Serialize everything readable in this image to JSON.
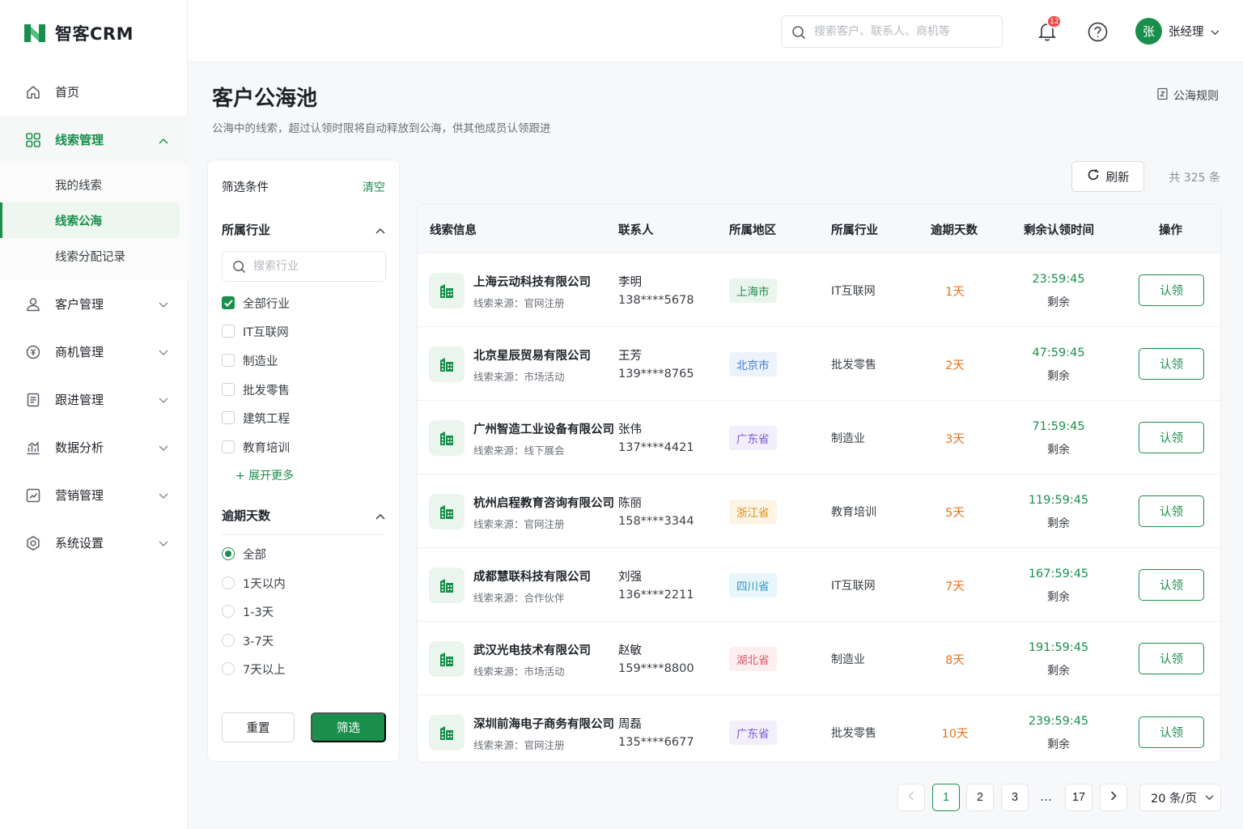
{
  "app": {
    "name": "智客CRM",
    "brand_color": "#1a8f4c"
  },
  "sidebar": {
    "items": [
      {
        "label": "首页",
        "icon": "home-icon"
      },
      {
        "label": "线索管理",
        "icon": "grid-icon",
        "expanded": true,
        "children": [
          {
            "label": "我的线索"
          },
          {
            "label": "线索公海",
            "active": true
          },
          {
            "label": "线索分配记录"
          }
        ]
      },
      {
        "label": "客户管理",
        "icon": "user-icon"
      },
      {
        "label": "商机管理",
        "icon": "coin-icon"
      },
      {
        "label": "跟进管理",
        "icon": "document-icon"
      },
      {
        "label": "数据分析",
        "icon": "chart-icon"
      },
      {
        "label": "营销管理",
        "icon": "marketing-icon"
      },
      {
        "label": "系统设置",
        "icon": "gear-icon"
      }
    ]
  },
  "header": {
    "search_placeholder": "搜索客户、联系人、商机等",
    "notification_count": "12",
    "user": {
      "avatar_text": "张",
      "name": "张经理"
    }
  },
  "page": {
    "title": "客户公海池",
    "description": "公海中的线索，超过认领时限将自动释放到公海，供其他成员认领跟进",
    "rules_link": "公海规则"
  },
  "filter": {
    "title": "筛选条件",
    "clear": "清空",
    "industry_section": "所属行业",
    "industry_search_placeholder": "搜索行业",
    "industry_options": [
      {
        "label": "全部行业",
        "checked": true
      },
      {
        "label": "IT互联网",
        "checked": false
      },
      {
        "label": "制造业",
        "checked": false
      },
      {
        "label": "批发零售",
        "checked": false
      },
      {
        "label": "建筑工程",
        "checked": false
      },
      {
        "label": "教育培训",
        "checked": false
      }
    ],
    "expand_more": "+ 展开更多",
    "overdue_section": "逾期天数",
    "overdue_options": [
      {
        "label": "全部",
        "selected": true
      },
      {
        "label": "1天以内",
        "selected": false
      },
      {
        "label": "1-3天",
        "selected": false
      },
      {
        "label": "3-7天",
        "selected": false
      },
      {
        "label": "7天以上",
        "selected": false
      }
    ],
    "reset_label": "重置",
    "submit_label": "筛选"
  },
  "toolbar": {
    "refresh_label": "刷新",
    "total_text": "共 325 条"
  },
  "table": {
    "columns": [
      "线索信息",
      "联系人",
      "所属地区",
      "所属行业",
      "逾期天数",
      "剩余认领时间",
      "操作"
    ],
    "rows": [
      {
        "company": "上海云动科技有限公司",
        "source": "线索来源：官网注册",
        "contact": "李明",
        "phone": "138****5678",
        "region": "上海市",
        "region_color": "#1a8f4c",
        "region_bg": "#eaf5ee",
        "industry": "IT互联网",
        "overdue": "1天",
        "remaining": "23:59:45",
        "remaining_label": "剩余",
        "action": "认领"
      },
      {
        "company": "北京星辰贸易有限公司",
        "source": "线索来源：市场活动",
        "contact": "王芳",
        "phone": "139****8765",
        "region": "北京市",
        "region_color": "#3b7bd8",
        "region_bg": "#ecf3fd",
        "industry": "批发零售",
        "overdue": "2天",
        "remaining": "47:59:45",
        "remaining_label": "剩余",
        "action": "认领"
      },
      {
        "company": "广州智造工业设备有限公司",
        "source": "线索来源：线下展会",
        "contact": "张伟",
        "phone": "137****4421",
        "region": "广东省",
        "region_color": "#7a5bd1",
        "region_bg": "#f2eefc",
        "industry": "制造业",
        "overdue": "3天",
        "remaining": "71:59:45",
        "remaining_label": "剩余",
        "action": "认领"
      },
      {
        "company": "杭州启程教育咨询有限公司",
        "source": "线索来源：官网注册",
        "contact": "陈丽",
        "phone": "158****3344",
        "region": "浙江省",
        "region_color": "#d6901c",
        "region_bg": "#fdf4e4",
        "industry": "教育培训",
        "overdue": "5天",
        "remaining": "119:59:45",
        "remaining_label": "剩余",
        "action": "认领"
      },
      {
        "company": "成都慧联科技有限公司",
        "source": "线索来源：合作伙伴",
        "contact": "刘强",
        "phone": "136****2211",
        "region": "四川省",
        "region_color": "#2f97c9",
        "region_bg": "#e8f5fb",
        "industry": "IT互联网",
        "overdue": "7天",
        "remaining": "167:59:45",
        "remaining_label": "剩余",
        "action": "认领"
      },
      {
        "company": "武汉光电技术有限公司",
        "source": "线索来源：市场活动",
        "contact": "赵敏",
        "phone": "159****8800",
        "region": "湖北省",
        "region_color": "#e0566a",
        "region_bg": "#fdeef0",
        "industry": "制造业",
        "overdue": "8天",
        "remaining": "191:59:45",
        "remaining_label": "剩余",
        "action": "认领"
      },
      {
        "company": "深圳前海电子商务有限公司",
        "source": "线索来源：官网注册",
        "contact": "周磊",
        "phone": "135****6677",
        "region": "广东省",
        "region_color": "#7a5bd1",
        "region_bg": "#f2eefc",
        "industry": "批发零售",
        "overdue": "10天",
        "remaining": "239:59:45",
        "remaining_label": "剩余",
        "action": "认领"
      }
    ]
  },
  "pagination": {
    "pages": [
      "1",
      "2",
      "3",
      "…",
      "17"
    ],
    "current": "1",
    "page_size": "20 条/页"
  }
}
